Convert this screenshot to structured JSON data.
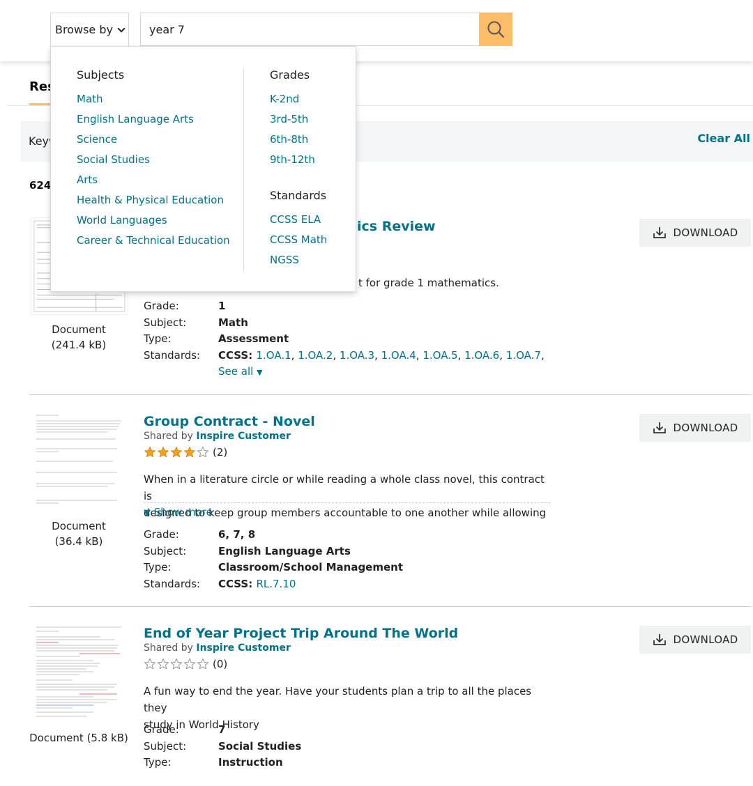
{
  "header": {
    "browse_label": "Browse by",
    "search_value": "year 7"
  },
  "dropdown": {
    "subjects_heading": "Subjects",
    "subjects": [
      "Math",
      "English Language Arts",
      "Science",
      "Social Studies",
      "Arts",
      "Health & Physical Education",
      "World Languages",
      "Career & Technical Education"
    ],
    "grades_heading": "Grades",
    "grades": [
      "K-2nd",
      "3rd-5th",
      "6th-8th",
      "9th-12th"
    ],
    "standards_heading": "Standards",
    "standards": [
      "CCSS ELA",
      "CCSS Math",
      "NGSS"
    ]
  },
  "results_bar": {
    "tab_label": "Res",
    "filter_label": "Keyw",
    "clear_all": "Clear All",
    "count": "624"
  },
  "results": [
    {
      "title_visible": "ics Review",
      "desc_visible": "t for grade 1 mathematics.",
      "doc_type": "Document",
      "doc_size": "(241.4 kB)",
      "download": "DOWNLOAD",
      "grade_label": "Grade:",
      "grade": "1",
      "subject_label": "Subject:",
      "subject": "Math",
      "type_label": "Type:",
      "type": "Assessment",
      "standards_label": "Standards:",
      "standards_prefix": "CCSS:",
      "standards": [
        "1.OA.1",
        "1.OA.2",
        "1.OA.3",
        "1.OA.4",
        "1.OA.5",
        "1.OA.6",
        "1.OA.7"
      ],
      "see_all": "See all"
    },
    {
      "title": "Group Contract - Novel",
      "shared_prefix": "Shared by",
      "shared_by": "Inspire Customer",
      "rating_stars": 4,
      "rating_count": "(2)",
      "desc_line1": "When in a literature circle or while reading a whole class novel, this contract is",
      "desc_line2": "designed to keep group members accountable to one another while allowing",
      "show_more": "Show more",
      "doc_type": "Document",
      "doc_size": "(36.4 kB)",
      "download": "DOWNLOAD",
      "grade_label": "Grade:",
      "grade": "6, 7, 8",
      "subject_label": "Subject:",
      "subject": "English Language Arts",
      "type_label": "Type:",
      "type": "Classroom/School Management",
      "standards_label": "Standards:",
      "standards_prefix": "CCSS:",
      "standards": [
        "RL.7.10"
      ]
    },
    {
      "title": "End of Year Project Trip Around The World",
      "shared_prefix": "Shared by",
      "shared_by": "Inspire Customer",
      "rating_stars": 0,
      "rating_count": "(0)",
      "desc_line1": "A fun way to end the year.  Have your students plan a trip to all the places they",
      "desc_line2": "study in World History",
      "doc_label": "Document (5.8 kB)",
      "download": "DOWNLOAD",
      "grade_label": "Grade:",
      "grade": "7",
      "subject_label": "Subject:",
      "subject": "Social Studies",
      "type_label": "Type:",
      "type": "Instruction"
    }
  ],
  "colors": {
    "link": "#00738a",
    "search_button": "#febd69",
    "star": "#f0a220",
    "download_bg": "#f0f2f2"
  }
}
